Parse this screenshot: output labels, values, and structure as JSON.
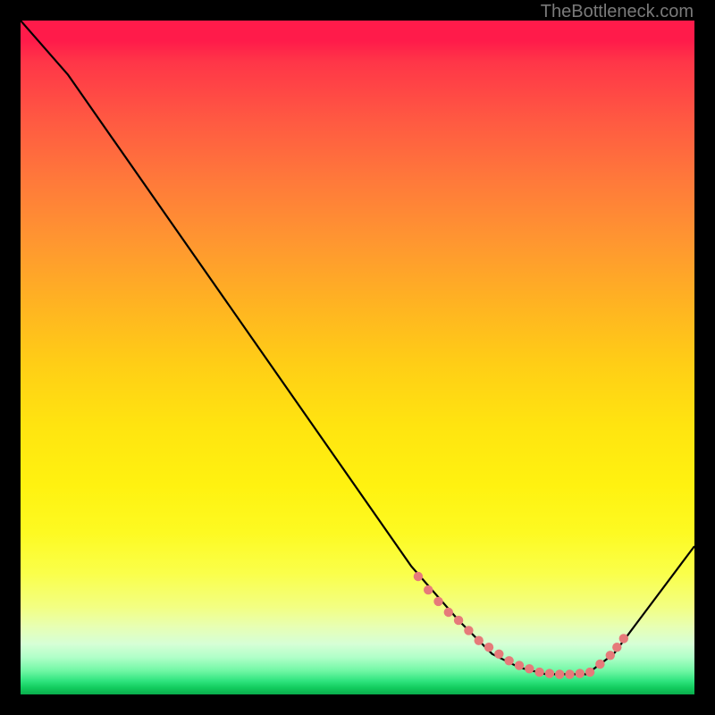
{
  "watermark": "TheBottleneck.com",
  "chart_data": {
    "type": "line",
    "title": "",
    "xlabel": "",
    "ylabel": "",
    "xlim": [
      0,
      100
    ],
    "ylim": [
      0,
      100
    ],
    "series": [
      {
        "name": "curve",
        "x": [
          0,
          7,
          58,
          65,
          70,
          74,
          78,
          82,
          84,
          88,
          91,
          100
        ],
        "y": [
          100,
          92,
          19,
          11,
          6,
          4,
          3,
          3,
          3,
          6,
          10,
          22
        ]
      }
    ],
    "markers": {
      "name": "dotted-region",
      "color": "#e67a7a",
      "points_x": [
        59,
        60.5,
        62,
        63.5,
        65,
        66.5,
        68,
        69.5,
        71,
        72.5,
        74,
        75.5,
        77,
        78.5,
        80,
        81.5,
        83,
        84.5,
        86,
        87.5,
        88.5,
        89.5
      ],
      "points_y": [
        17.5,
        15.5,
        13.8,
        12.2,
        11,
        9.5,
        8,
        7,
        6,
        5,
        4.3,
        3.8,
        3.3,
        3.1,
        3,
        3,
        3.1,
        3.3,
        4.5,
        5.8,
        7,
        8.3
      ]
    },
    "colors": {
      "line": "#000000",
      "marker": "#e67a7a"
    }
  }
}
